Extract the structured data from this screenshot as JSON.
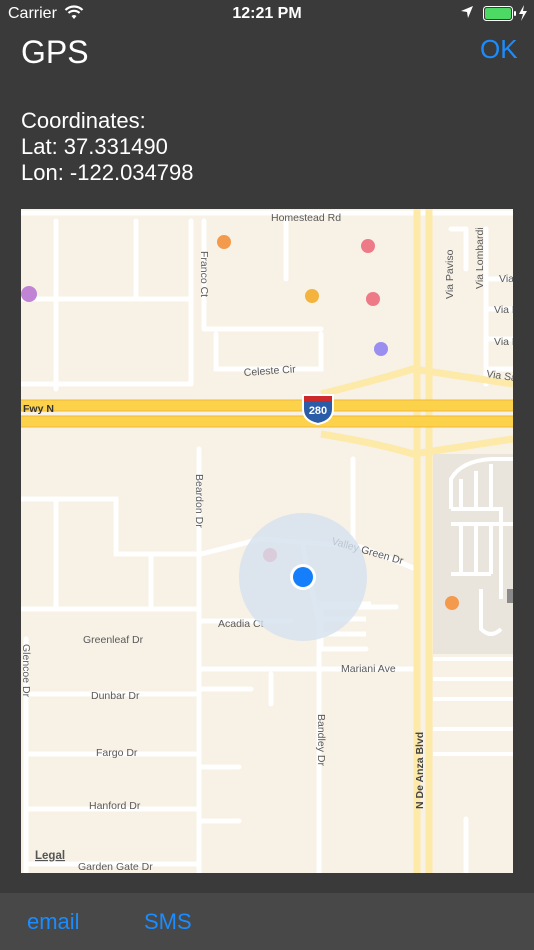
{
  "status_bar": {
    "carrier": "Carrier",
    "time": "12:21 PM"
  },
  "nav": {
    "title": "GPS",
    "ok_label": "OK"
  },
  "coordinates": {
    "heading": "Coordinates:",
    "lat": "Lat: 37.331490",
    "lon": "Lon: -122.034798"
  },
  "map": {
    "legal": "Legal",
    "streets": {
      "homestead": "Homestead Rd",
      "franco": "Franco Ct",
      "celeste": "Celeste Cir",
      "fwy": "Fwy N",
      "shield": "280",
      "beardon": "Beardon Dr",
      "valley_green": "Valley Green Dr",
      "acadia": "Acadia Ct",
      "greenleaf": "Greenleaf Dr",
      "glencoe": "Glencoe Dr",
      "mariani": "Mariani Ave",
      "dunbar": "Dunbar Dr",
      "bandley": "Bandley Dr",
      "de_anza": "N De Anza Blvd",
      "fargo": "Fargo Dr",
      "hanford": "Hanford Dr",
      "garden_gate": "Garden Gate Dr",
      "via_paviso": "Via Paviso",
      "via_lombardi": "Via Lombardi",
      "via_1": "Via",
      "via_2": "Via P",
      "via_3": "Via P",
      "via_sa": "Via Sa"
    },
    "colors": {
      "land": "#f7f1e6",
      "freeway": "#fbd249",
      "major_road": "#fde9a8",
      "road": "#ffffff",
      "user_dot": "#147efb",
      "accuracy": "#dfe6ee"
    }
  },
  "bottom_bar": {
    "email_label": "email",
    "sms_label": "SMS"
  }
}
